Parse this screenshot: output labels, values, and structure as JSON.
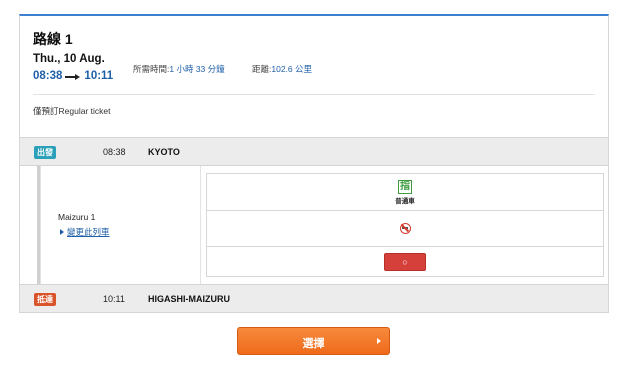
{
  "route": {
    "title": "路線 1",
    "date": "Thu., 10 Aug.",
    "depart_time": "08:38",
    "arrive_time": "10:11",
    "duration_label": "所需時間:",
    "duration_value": "1 小時 33 分鐘",
    "distance_label": "距離:",
    "distance_value": "102.6 公里",
    "ticket_note": "僅預訂Regular ticket"
  },
  "departure": {
    "badge": "出發",
    "time": "08:38",
    "station": "KYOTO",
    "badge_color": "#2aa0b9"
  },
  "train": {
    "name": "Maizuru 1",
    "change_link": "變更此列車",
    "reserved_icon_char": "指",
    "car_type": "普通車",
    "seat_button_symbol": "○",
    "icons": [
      "reserved-seat-icon",
      "no-smoking-icon"
    ]
  },
  "arrival": {
    "badge": "抵達",
    "time": "10:11",
    "station": "HIGASHI-MAIZURU",
    "badge_color": "#d9542b"
  },
  "actions": {
    "select_label": "選擇"
  },
  "colors": {
    "accent_blue": "#1f5fa8",
    "select_orange": "#ef6a1b",
    "seat_red": "#d5403a"
  }
}
